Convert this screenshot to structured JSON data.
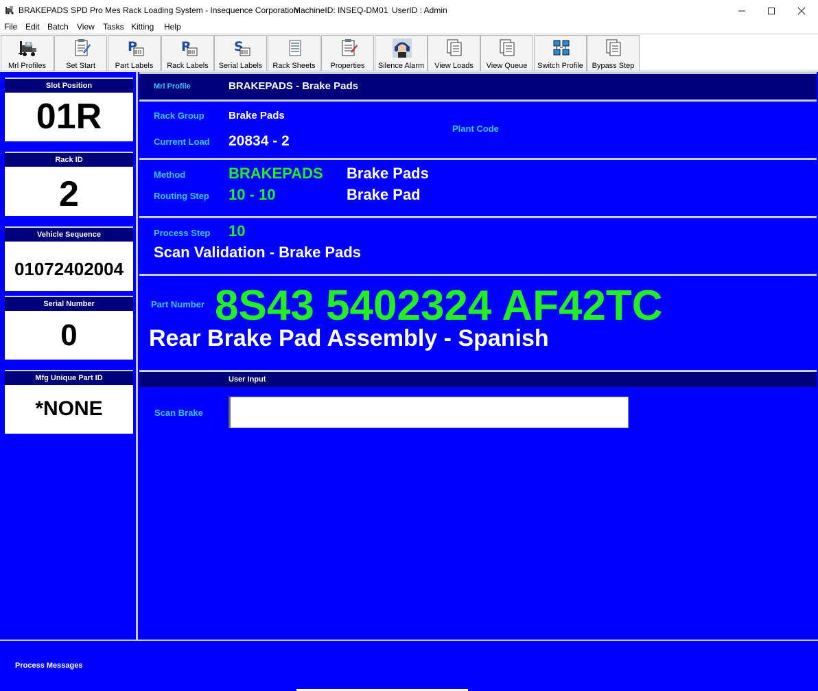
{
  "window": {
    "app_name": "BRAKEPADS",
    "title": "SPD Pro Mes Rack Loading System - Insequence Corporation",
    "machine": "MachineID: INSEQ-DM01",
    "user": "UserID : Admin"
  },
  "menu": [
    "File",
    "Edit",
    "Batch",
    "View",
    "Tasks",
    "Kitting",
    "Help"
  ],
  "toolbar": [
    {
      "label": "Mrl Profiles",
      "icon": "forklift-icon"
    },
    {
      "label": "Set Start",
      "icon": "clipboard-pencil-icon"
    },
    {
      "label": "Part Labels",
      "icon": "label-p-icon"
    },
    {
      "label": "Rack Labels",
      "icon": "label-r-icon"
    },
    {
      "label": "Serial Labels",
      "icon": "label-s-icon"
    },
    {
      "label": "Rack Sheets",
      "icon": "sheets-icon"
    },
    {
      "label": "Properties",
      "icon": "properties-icon"
    },
    {
      "label": "Silence Alarm",
      "icon": "ear-muffs-icon"
    },
    {
      "label": "View Loads",
      "icon": "documents-icon"
    },
    {
      "label": "View Queue",
      "icon": "documents-icon"
    },
    {
      "label": "Switch Profile",
      "icon": "switch-network-icon"
    },
    {
      "label": "Bypass Step",
      "icon": "documents-icon"
    }
  ],
  "sidebar": {
    "slot_position": {
      "label": "Slot Position",
      "value": "01R"
    },
    "rack_id": {
      "label": "Rack ID",
      "value": "2"
    },
    "vehicle_sequence": {
      "label": "Vehicle Sequence",
      "value": "01072402004"
    },
    "serial_number": {
      "label": "Serial Number",
      "value": "0"
    },
    "mfg_unique_part_id": {
      "label": "Mfg Unique Part ID",
      "value": "*NONE"
    }
  },
  "profile": {
    "label": "Mrl Profile",
    "value": "BRAKEPADS - Brake Pads"
  },
  "rack": {
    "group_label": "Rack Group",
    "group_value": "Brake Pads",
    "load_label": "Current Load",
    "load_value": "20834 - 2",
    "plant_label": "Plant Code"
  },
  "method": {
    "label": "Method",
    "code": "BRAKEPADS",
    "name": "Brake Pads",
    "routing_label": "Routing Step",
    "routing_code": "10 - 10",
    "routing_name": "Brake Pad"
  },
  "process": {
    "label": "Process Step",
    "code": "10",
    "description": "Scan Validation - Brake Pads"
  },
  "part": {
    "label": "Part Number",
    "number": "8S43 5402324 AF42TC",
    "description": "Rear Brake Pad Assembly - Spanish"
  },
  "user_input": {
    "header": "User Input",
    "prompt": "Scan Brake",
    "value": ""
  },
  "messages": {
    "label": "Process Messages"
  },
  "colors": {
    "background": "#0000ff",
    "header": "#00007a",
    "label": "#38c8ff",
    "highlight": "#22ee22"
  }
}
